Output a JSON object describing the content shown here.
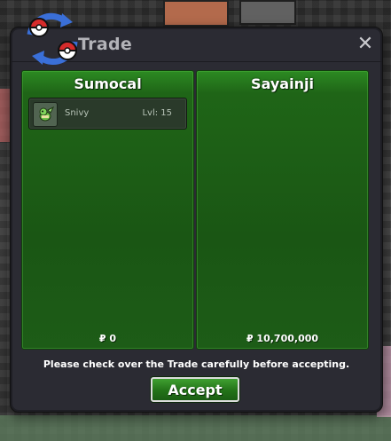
{
  "window": {
    "title": "Trade",
    "close_glyph": "✕",
    "logo_icon": "pokeball-trade-arrows-icon"
  },
  "panels": [
    {
      "player": "Sumocal",
      "money": "₽ 0",
      "pokemon": [
        {
          "name": "Snivy",
          "level": "Lvl: 15",
          "icon": "snivy-icon"
        }
      ]
    },
    {
      "player": "Sayainji",
      "money": "₽ 10,700,000",
      "pokemon": []
    }
  ],
  "notice": "Please check over the Trade carefully before accepting.",
  "accept_label": "Accept",
  "colors": {
    "panel_green": "#1f6517",
    "window_bg": "#2b2b33",
    "title_text": "#b3b3b8"
  }
}
